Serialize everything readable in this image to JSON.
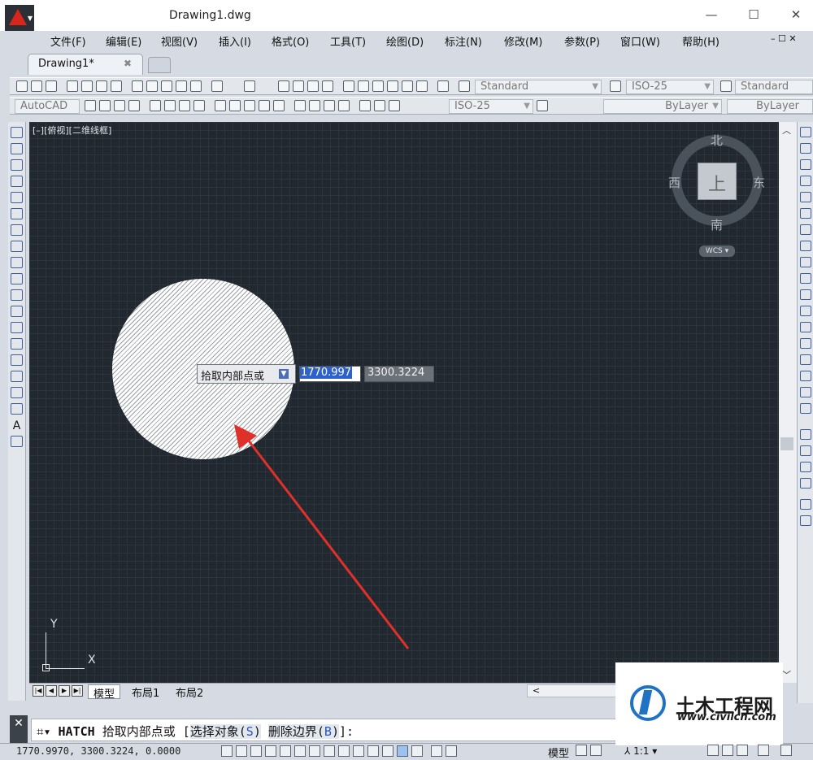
{
  "window": {
    "title": "Drawing1.dwg",
    "minimize": "—",
    "maximize": "☐",
    "close": "✕"
  },
  "menu": [
    "文件(F)",
    "编辑(E)",
    "视图(V)",
    "插入(I)",
    "格式(O)",
    "工具(T)",
    "绘图(D)",
    "标注(N)",
    "修改(M)",
    "参数(P)",
    "窗口(W)",
    "帮助(H)"
  ],
  "menu_right": "– ☐ ✕",
  "tabs": {
    "active": "Drawing1*",
    "close": "✖"
  },
  "toolbar1": {
    "text_style": "Standard",
    "dim_style": "ISO-25",
    "table_style": "Standard"
  },
  "toolbar2": {
    "workspace": "AutoCAD",
    "dim_style": "ISO-25",
    "color": "ByLayer",
    "linetype": "ByLayer"
  },
  "viewport": {
    "label": "[–][俯视][二维线框]"
  },
  "compass": {
    "north": "北",
    "south": "南",
    "west": "西",
    "east": "东",
    "face": "上",
    "wcs": "WCS ▾"
  },
  "ucs": {
    "y": "Y",
    "x": "X"
  },
  "dynamic_input": {
    "prompt": "拾取内部点或",
    "x_value": "1770.997",
    "y_value": "3300.3224"
  },
  "layout_tabs": [
    "模型",
    "布局1",
    "布局2"
  ],
  "command": {
    "icon": "⌗▾",
    "name": "HATCH",
    "prompt": "拾取内部点或 [",
    "option1_label": "选择对象(",
    "option1_key": "S",
    "option1_end": ")",
    "option2_label": "删除边界(",
    "option2_key": "B",
    "option2_end": ")",
    "tail": "]:"
  },
  "status": {
    "coords": "1770.9970, 3300.3224, 0.0000",
    "model": "模型",
    "scale": "⅄ 1:1 ▾"
  },
  "watermark": {
    "title": "土木工程网",
    "url": "www.civilcn.com"
  },
  "colors": {
    "canvas": "#212830",
    "arrow": "#e0302a",
    "accent": "#2e62c9",
    "logo_red": "#d9261c",
    "watermark_blue": "#1f72c4"
  }
}
